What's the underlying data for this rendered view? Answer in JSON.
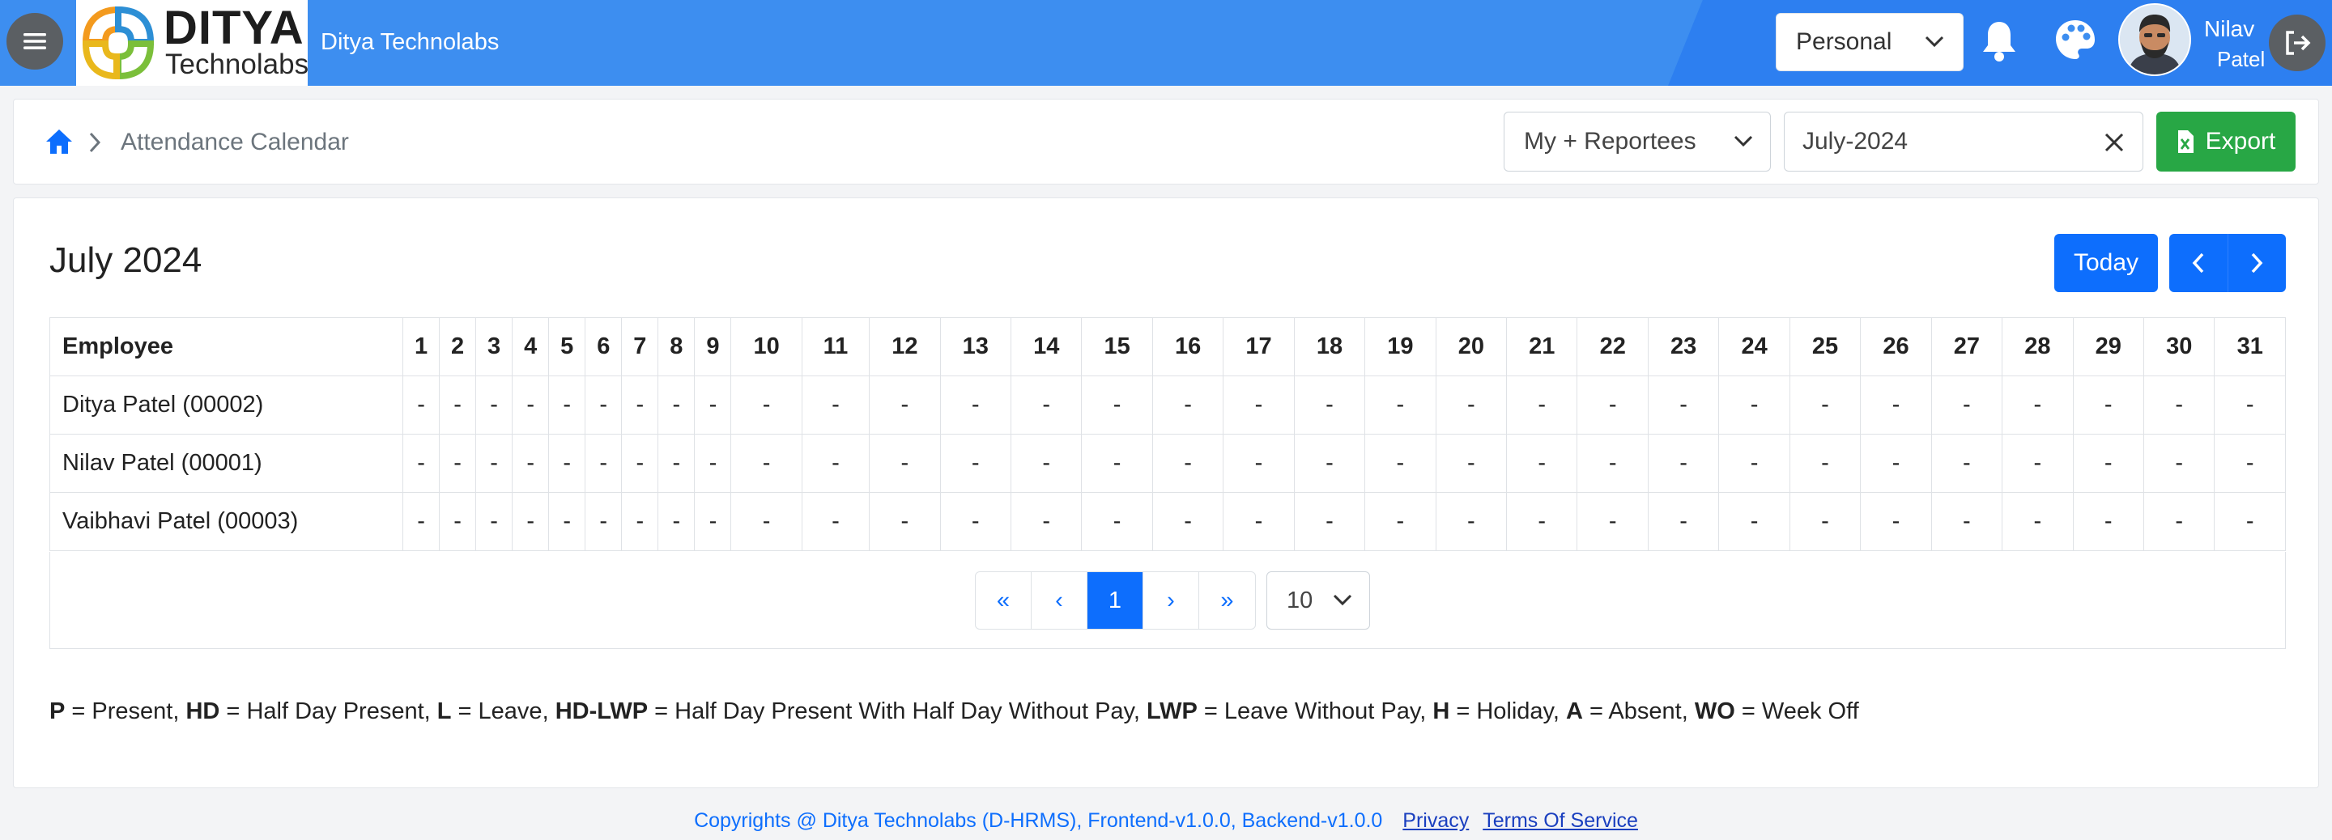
{
  "header": {
    "logo_word1": "DITYA",
    "logo_word2": "Technolabs",
    "company_name": "Ditya Technolabs",
    "context_select": "Personal",
    "user_first_name": "Nilav",
    "user_last_name": "Patel",
    "bar_color": "#3d8ef0"
  },
  "breadcrumb": {
    "current": "Attendance Calendar"
  },
  "filters": {
    "scope": "My + Reportees",
    "month": "July-2024",
    "export_label": "Export"
  },
  "calendar": {
    "title": "July 2024",
    "today_label": "Today",
    "employee_header": "Employee",
    "days": [
      "1",
      "2",
      "3",
      "4",
      "5",
      "6",
      "7",
      "8",
      "9",
      "10",
      "11",
      "12",
      "13",
      "14",
      "15",
      "16",
      "17",
      "18",
      "19",
      "20",
      "21",
      "22",
      "23",
      "24",
      "25",
      "26",
      "27",
      "28",
      "29",
      "30",
      "31"
    ],
    "rows": [
      {
        "name": "Ditya Patel (00002)",
        "marks": [
          "-",
          "-",
          "-",
          "-",
          "-",
          "-",
          "-",
          "-",
          "-",
          "-",
          "-",
          "-",
          "-",
          "-",
          "-",
          "-",
          "-",
          "-",
          "-",
          "-",
          "-",
          "-",
          "-",
          "-",
          "-",
          "-",
          "-",
          "-",
          "-",
          "-",
          "-"
        ]
      },
      {
        "name": "Nilav Patel (00001)",
        "marks": [
          "-",
          "-",
          "-",
          "-",
          "-",
          "-",
          "-",
          "-",
          "-",
          "-",
          "-",
          "-",
          "-",
          "-",
          "-",
          "-",
          "-",
          "-",
          "-",
          "-",
          "-",
          "-",
          "-",
          "-",
          "-",
          "-",
          "-",
          "-",
          "-",
          "-",
          "-"
        ]
      },
      {
        "name": "Vaibhavi Patel (00003)",
        "marks": [
          "-",
          "-",
          "-",
          "-",
          "-",
          "-",
          "-",
          "-",
          "-",
          "-",
          "-",
          "-",
          "-",
          "-",
          "-",
          "-",
          "-",
          "-",
          "-",
          "-",
          "-",
          "-",
          "-",
          "-",
          "-",
          "-",
          "-",
          "-",
          "-",
          "-",
          "-"
        ]
      }
    ]
  },
  "pagination": {
    "first": "«",
    "prev": "‹",
    "current_page": "1",
    "next": "›",
    "last": "»",
    "page_size": "10"
  },
  "legend": [
    {
      "code": "P",
      "meaning": "Present"
    },
    {
      "code": "HD",
      "meaning": "Half Day Present"
    },
    {
      "code": "L",
      "meaning": "Leave"
    },
    {
      "code": "HD-LWP",
      "meaning": "Half Day Present With Half Day Without Pay"
    },
    {
      "code": "LWP",
      "meaning": "Leave Without Pay"
    },
    {
      "code": "H",
      "meaning": "Holiday"
    },
    {
      "code": "A",
      "meaning": "Absent"
    },
    {
      "code": "WO",
      "meaning": "Week Off"
    }
  ],
  "footer": {
    "copyright": "Copyrights @ Ditya Technolabs (D-HRMS), Frontend-v1.0.0, Backend-v1.0.0",
    "privacy": "Privacy",
    "terms": "Terms Of Service"
  },
  "colors": {
    "primary": "#0d6efd",
    "success": "#28a745",
    "header": "#3d8ef0"
  },
  "icons": [
    "hamburger-menu-icon",
    "chevron-down-icon",
    "bell-icon",
    "palette-icon",
    "logout-icon",
    "home-icon",
    "chevron-right-icon",
    "close-icon",
    "excel-file-icon",
    "chevron-left-icon"
  ]
}
